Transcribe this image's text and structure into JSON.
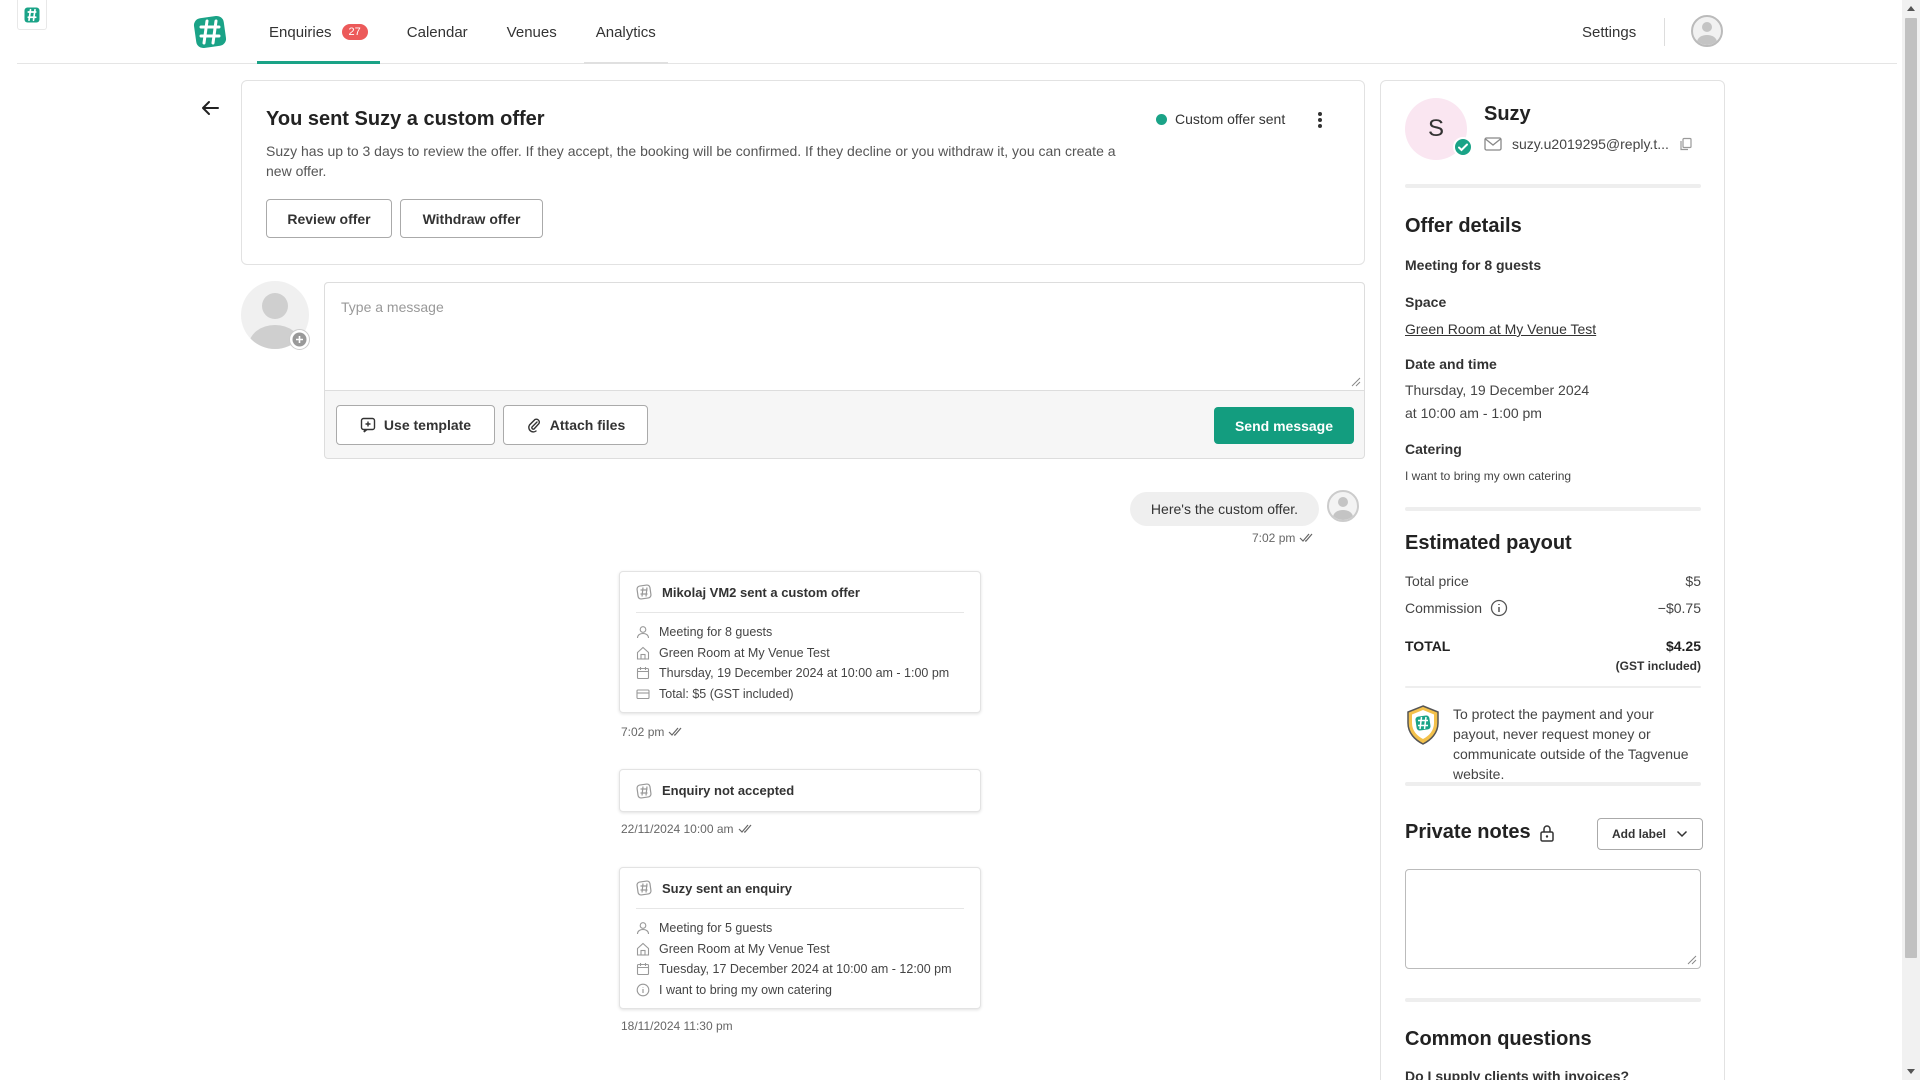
{
  "nav": {
    "items": [
      {
        "label": "Enquiries",
        "badge": "27"
      },
      {
        "label": "Calendar"
      },
      {
        "label": "Venues"
      },
      {
        "label": "Analytics"
      }
    ],
    "settings": "Settings"
  },
  "offer": {
    "title": "You sent Suzy a custom offer",
    "description": "Suzy has up to 3 days to review the offer. If they accept, the booking will be confirmed. If they decline or you withdraw it, you can create a new offer.",
    "status": "Custom offer sent",
    "review_button": "Review offer",
    "withdraw_button": "Withdraw offer"
  },
  "composer": {
    "placeholder": "Type a message",
    "template_button": "Use template",
    "attach_button": "Attach files",
    "send_button": "Send message"
  },
  "chat": {
    "bubble": {
      "text": "Here's the custom offer.",
      "time": "7:02 pm"
    },
    "cards": [
      {
        "title": "Mikolaj VM2 sent a custom offer",
        "rows": [
          {
            "icon": "guests-icon",
            "text": "Meeting for 8 guests"
          },
          {
            "icon": "venue-icon",
            "text": "Green Room at My Venue Test"
          },
          {
            "icon": "calendar-icon",
            "text": "Thursday, 19 December 2024 at 10:00 am - 1:00 pm"
          },
          {
            "icon": "card-icon",
            "text": "Total: $5 (GST included)"
          }
        ],
        "time": "7:02 pm"
      },
      {
        "title": "Enquiry not accepted",
        "rows": [],
        "time": "22/11/2024 10:00 am"
      },
      {
        "title": "Suzy sent an enquiry",
        "rows": [
          {
            "icon": "guests-icon",
            "text": "Meeting for 5 guests"
          },
          {
            "icon": "venue-icon",
            "text": "Green Room at My Venue Test"
          },
          {
            "icon": "calendar-icon",
            "text": "Tuesday, 17 December 2024 at 10:00 am - 12:00 pm"
          },
          {
            "icon": "info-icon",
            "text": "I want to bring my own catering"
          }
        ],
        "time": "18/11/2024 11:30 pm"
      }
    ]
  },
  "panel": {
    "avatar_initial": "S",
    "name": "Suzy",
    "email": "suzy.u2019295@reply.t...",
    "offer_heading": "Offer details",
    "meeting": "Meeting for 8 guests",
    "space_label": "Space",
    "space_value": "Green Room at My Venue Test",
    "datetime_label": "Date and time",
    "date_value": "Thursday, 19 December 2024",
    "time_value": "at 10:00 am - 1:00 pm",
    "catering_label": "Catering",
    "catering_value": "I want to bring my own catering",
    "payout_heading": "Estimated payout",
    "total_price_label": "Total price",
    "total_price_value": "$5",
    "commission_label": "Commission",
    "commission_value": "−$0.75",
    "total_label": "TOTAL",
    "total_value": "$4.25",
    "gst_note": "(GST included)",
    "protect_text": "To protect the payment and your payout, never request money or communicate outside of the Tagvenue website.",
    "notes_heading": "Private notes",
    "add_label": "Add label",
    "faq_heading": "Common questions",
    "faq_first": "Do I supply clients with invoices?"
  },
  "colors": {
    "accent": "#1aa387",
    "button": "#139d7f",
    "badge": "#ec5a5a"
  }
}
